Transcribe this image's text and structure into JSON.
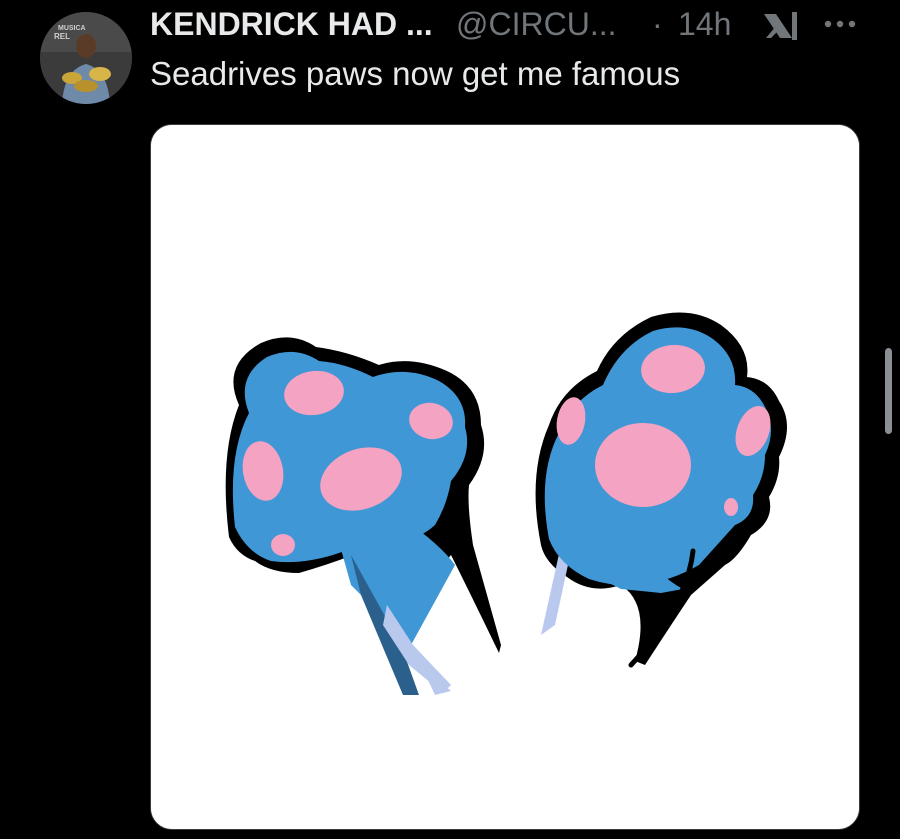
{
  "post": {
    "display_name": "KENDRICK HAD ...",
    "handle": "@CIRCU...",
    "separator": "·",
    "timestamp": "14h",
    "text": "Seadrives paws now get me famous",
    "media_alt": "Cartoon illustration of two blue cat paws with pink toe beans",
    "icons": {
      "avatar": "avatar-photo",
      "grok": "xai-grok-icon",
      "more": "more-options-icon"
    }
  },
  "colors": {
    "background": "#000000",
    "primary_text": "#e7e9ea",
    "secondary_text": "#71767b",
    "paw_blue": "#3f97d6",
    "paw_pink": "#f4a3c2",
    "paw_shadow": "#2b5f8c",
    "paw_streak": "#b9c9ee"
  }
}
